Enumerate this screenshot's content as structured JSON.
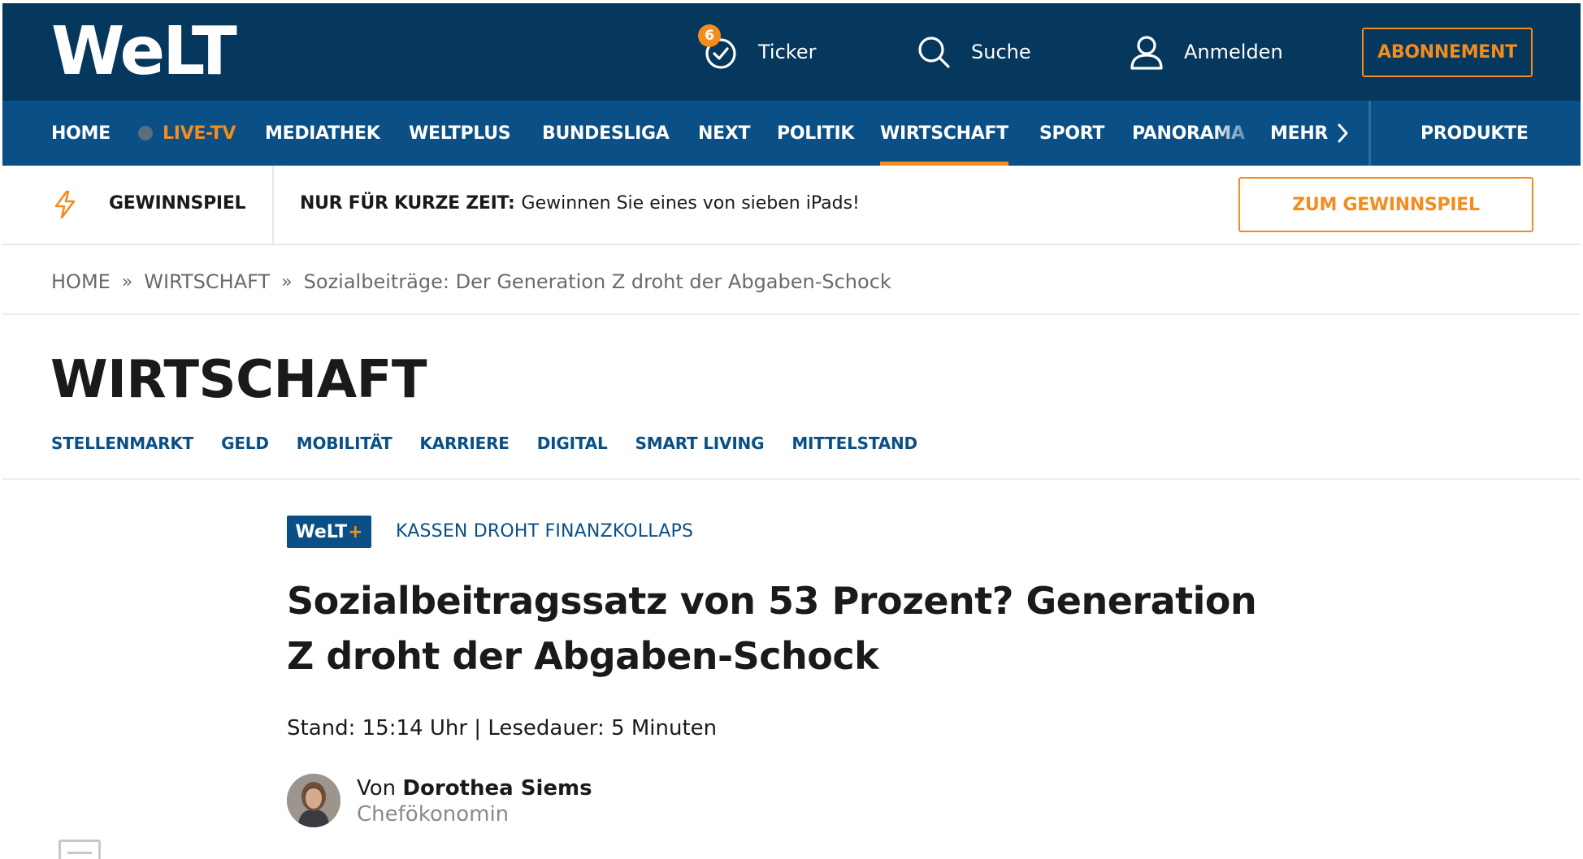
{
  "header": {
    "logo": "WeLT",
    "ticker": {
      "badge": "6",
      "label": "Ticker"
    },
    "search": {
      "label": "Suche"
    },
    "login": {
      "label": "Anmelden"
    },
    "subscribe": "ABONNEMENT"
  },
  "nav": {
    "items": [
      {
        "label": "HOME"
      },
      {
        "label": "LIVE-TV"
      },
      {
        "label": "MEDIATHEK"
      },
      {
        "label": "WELTPLUS"
      },
      {
        "label": "BUNDESLIGA"
      },
      {
        "label": "NEXT"
      },
      {
        "label": "POLITIK"
      },
      {
        "label": "WIRTSCHAFT"
      },
      {
        "label": "SPORT"
      },
      {
        "label": "PANORAMA"
      }
    ],
    "more": "MEHR",
    "products": "PRODUKTE"
  },
  "promo": {
    "label": "GEWINNSPIEL",
    "lead": "NUR FÜR KURZE ZEIT:",
    "text": "Gewinnen Sie eines von sieben iPads!",
    "button": "ZUM GEWINNSPIEL"
  },
  "breadcrumb": {
    "items": [
      "HOME",
      "WIRTSCHAFT",
      "Sozialbeiträge: Der Generation Z droht der Abgaben-Schock"
    ],
    "separator": "»"
  },
  "section": {
    "title": "WIRTSCHAFT",
    "subnav": [
      "STELLENMARKT",
      "GELD",
      "MOBILITÄT",
      "KARRIERE",
      "DIGITAL",
      "SMART LIVING",
      "MITTELSTAND"
    ]
  },
  "article": {
    "badge_main": "WeLT",
    "badge_plus": "+",
    "kicker": "KASSEN DROHT FINANZKOLLAPS",
    "headline": "Sozialbeitragssatz von 53 Prozent? Generation Z droht der Abgaben-Schock",
    "meta": "Stand: 15:14 Uhr | Lesedauer: 5 Minuten",
    "byline_prefix": "Von ",
    "author": "Dorothea Siems",
    "author_role": "Chefökonomin"
  },
  "colors": {
    "header_bg": "#06375c",
    "nav_bg": "#0a4f86",
    "accent": "#f48c1e"
  }
}
